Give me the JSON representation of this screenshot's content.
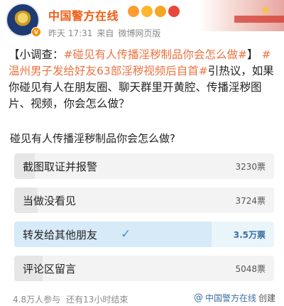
{
  "account": {
    "name": "中国警方在线",
    "time": "昨天 17:31",
    "source_prefix": "来自",
    "source": "微博网页版",
    "vip_mark": "V"
  },
  "post": {
    "bracket_text": "【小调查：",
    "topic1": "#碰见有人传播淫秽制品你会怎么做#",
    "bracket_close": "】",
    "topic2": "#温州男子发给好友63部淫秽视频后自首#",
    "body": "引热议，如果你碰见有人在朋友圈、聊天群里开黄腔、传播淫秽图片、视频，你会怎么做？"
  },
  "poll": {
    "question": "碰见有人传播淫秽制品你会怎么做?",
    "options": [
      {
        "label": "截图取证并报警",
        "count": "3230票",
        "share": 0.08
      },
      {
        "label": "当做没看见",
        "count": "3724票",
        "share": 0.09
      },
      {
        "label": "转发给其他朋友",
        "count": "3.5万票",
        "share": 0.76,
        "selected": true
      },
      {
        "label": "评论区留言",
        "count": "5048票",
        "share": 0.11
      }
    ],
    "participants": "4.8万人参与",
    "remaining": "还有13小时结束",
    "creator_at": "@",
    "creator": "中国警方在线",
    "created_label": "创建"
  },
  "colors": {
    "name": "#f15d14",
    "topic": "#eb7340",
    "selected_bg": "#d6eaf8",
    "link": "#3a6fa3"
  }
}
